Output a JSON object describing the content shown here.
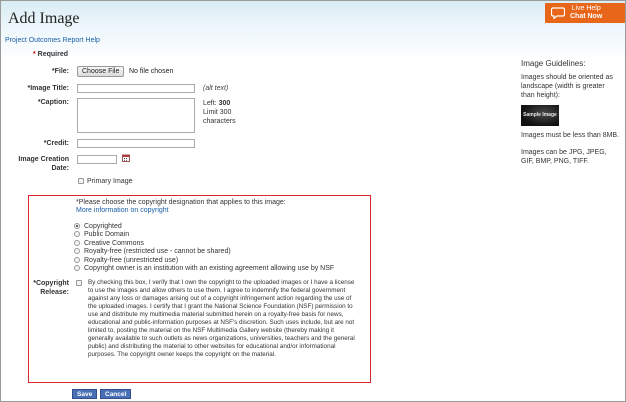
{
  "page": {
    "title": "Add Image",
    "help_link": "Project Outcomes Report Help"
  },
  "live_help": {
    "line1": "Live Help",
    "line2": "Chat Now",
    "icon": "chat-bubble-icon"
  },
  "required_note": {
    "star": "*",
    "text": " Required"
  },
  "form": {
    "file": {
      "label": "*File:",
      "button": "Choose File",
      "status": "No file chosen"
    },
    "image_title": {
      "label": "*Image Title:",
      "value": "",
      "hint": "(alt text)"
    },
    "caption": {
      "label": "*Caption:",
      "value": "",
      "left_label": "Left:",
      "left_value": "300",
      "limit_line1": "Limit 300",
      "limit_line2": "characters"
    },
    "credit": {
      "label": "*Credit:",
      "value": ""
    },
    "creation_date": {
      "label_line1": "Image Creation",
      "label_line2": "Date:",
      "value": "",
      "icon": "calendar-icon"
    },
    "primary_image": {
      "label": "Primary Image",
      "checked": false
    }
  },
  "copyright": {
    "prompt": "*Please choose the copyright designation that applies to this image:",
    "more_info_link": "More information on copyright",
    "options": [
      {
        "label": "Copyrighted",
        "selected": true
      },
      {
        "label": "Public Domain",
        "selected": false
      },
      {
        "label": "Creative Commons",
        "selected": false
      },
      {
        "label": "Royalty-free (restricted use - cannot be shared)",
        "selected": false
      },
      {
        "label": "Royalty-free (unrestricted use)",
        "selected": false
      },
      {
        "label": "Copyright owner is an institution with an existing agreement allowing use by NSF",
        "selected": false
      }
    ],
    "release_label_line1": "*Copyright",
    "release_label_line2": "Release:",
    "release_checked": false,
    "release_text": "By checking this box, I verify that I own the copyright to the uploaded images or I have a license to use the images and allow others to use them. I agree to indemnify the federal government against any loss or damages arising out of a copyright infringement action regarding the use of the uploaded images. I certify that I grant the National Science Foundation (NSF) permission to use and distribute my multimedia material submitted herein on a royalty-free basis for news, educational and public-information purposes at NSF's discretion. Such uses include, but are not limited to, posting the material on the NSF Multimedia Gallery website (thereby making it generally available to such outlets as news organizations, universities, teachers and the general public) and distributing the material to other websites for educational and/or informational purposes. The copyright owner keeps the copyright on the material."
  },
  "buttons": {
    "save": "Save",
    "cancel": "Cancel"
  },
  "guidelines": {
    "title": "Image Guidelines:",
    "orientation_line1": "Images should be oriented as",
    "orientation_line2": "landscape (width is greater",
    "orientation_line3": "than height):",
    "sample_caption": "Sample Image",
    "size_note": "Images must be less than 8MB.",
    "types_line1": "Images can be JPG, JPEG,",
    "types_line2": "GIF, BMP, PNG, TIFF."
  },
  "colors": {
    "accent": "#e8661a",
    "link": "#1a5fa8",
    "highlight_box": "#d9272e",
    "button": "#4a6fb5"
  }
}
